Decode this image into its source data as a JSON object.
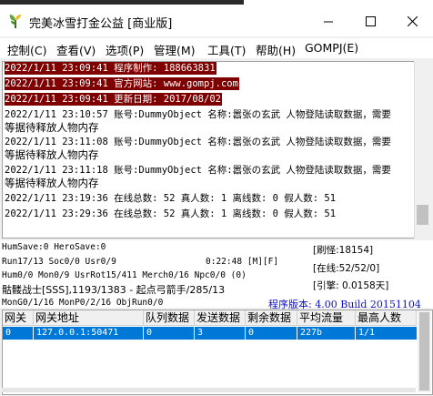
{
  "window": {
    "title": "完美冰雪打金公益 [商业版]",
    "minimize_glyph": "—",
    "maximize_glyph": "☐",
    "close_glyph": "✕",
    "icon": "plant-app-icon"
  },
  "menu": [
    "控制(C)",
    "查看(V)",
    "选项(P)",
    "管理(M)",
    "工具(T)",
    "帮助(H)",
    "GOMPJ(E)"
  ],
  "log": [
    {
      "text": "2022/1/11 23:09:41 程序制作: 188663831",
      "highlight": true
    },
    {
      "text": "2022/1/11 23:09:41 官方网站: www.gompj.com",
      "highlight": true
    },
    {
      "text": "2022/1/11 23:09:41 更新日期: 2017/08/02",
      "highlight": true
    },
    {
      "text": "2022/1/11 23:10:57 账号:DummyObject 名称:嚣张の玄武 人物登陆读取数据，需要",
      "highlight": false
    },
    {
      "text": "等据待释放人物内存",
      "highlight": false
    },
    {
      "text": "2022/1/11 23:11:08 账号:DummyObject 名称:嚣张の玄武 人物登陆读取数据，需要",
      "highlight": false
    },
    {
      "text": "等据待释放人物内存",
      "highlight": false
    },
    {
      "text": "2022/1/11 23:11:18 账号:DummyObject 名称:嚣张の玄武 人物登陆读取数据，需要",
      "highlight": false
    },
    {
      "text": "等据待释放人物内存",
      "highlight": false
    },
    {
      "text": "2022/1/11 23:19:36 在线总数: 52 真人数: 1 离线数: 0 假人数: 51",
      "highlight": false
    },
    {
      "text": "2022/1/11 23:29:36 在线总数: 52 真人数: 1 离线数: 0 假人数: 51",
      "highlight": false
    }
  ],
  "status": {
    "line1": "HumSave:0 HeroSave:0",
    "line2": "Run17/13 Soc0/0 Usr0/9",
    "time": "0:22:48 [M][F]",
    "line3": "Hum0/0 Mon0/9 UsrRot15/411 Merch0/16 Npc0/0 (0)",
    "line4": "骷髅战士[SSS],1193/1383 - 起点弓箭手/285/13",
    "line5": "MonG0/1/16 MonP0/2/16 ObjRun0/0",
    "refresh": "[刷怪:18154]",
    "online": "[在线:52/52/0]",
    "engine": "[引擎: 0.0158天]",
    "version": "程序版本: 4.00 Build 20151104"
  },
  "table": {
    "headers": [
      "网关",
      "网关地址",
      "队列数据",
      "发送数据",
      "剩余数据",
      "平均流量",
      "最高人数"
    ],
    "rows": [
      [
        "0",
        "127.0.0.1:50471",
        "0",
        "3",
        "0",
        "227b",
        "1/1"
      ]
    ]
  },
  "colors": {
    "log_highlight": "#7e0000",
    "selection": "#0078d7",
    "version_text": "#1010c0"
  }
}
